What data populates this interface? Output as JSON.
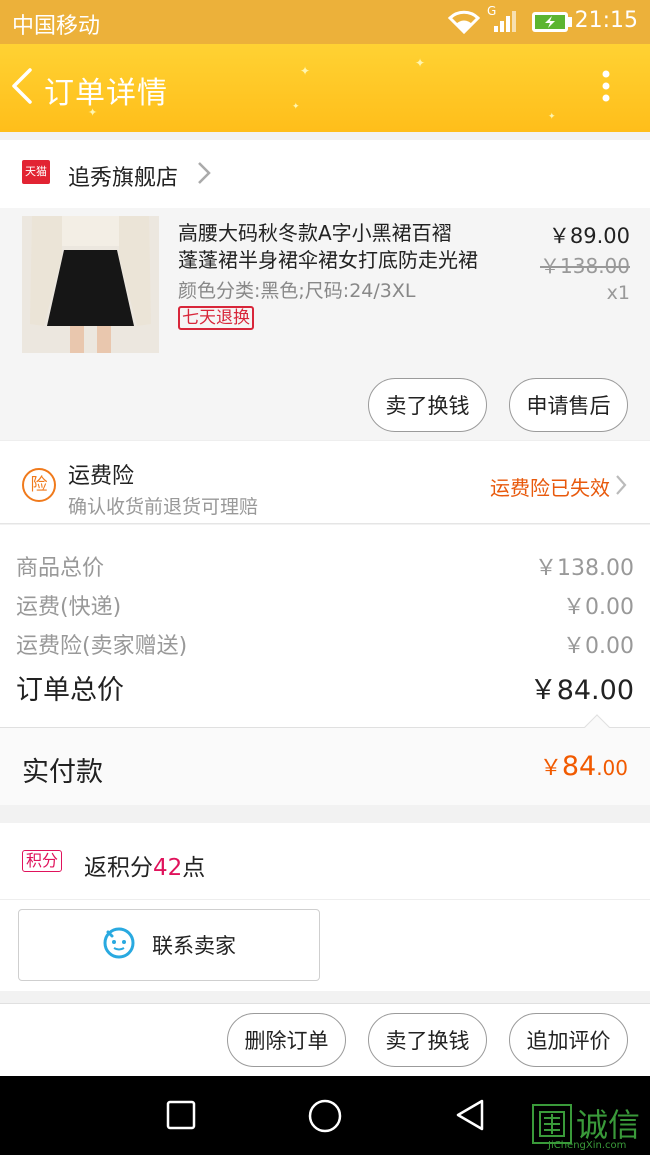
{
  "status_bar": {
    "carrier": "中国移动",
    "time": "21:15",
    "network": "G"
  },
  "nav": {
    "title": "订单详情"
  },
  "store": {
    "badge": "天猫",
    "name": "追秀旗舰店"
  },
  "product": {
    "name_line1": "高腰大码秋冬款A字小黑裙百褶",
    "name_line2": "蓬蓬裙半身裙伞裙女打底防走光裙",
    "spec": "颜色分类:黑色;尺码:24/3XL",
    "tag": "七天退换",
    "price": "￥89.00",
    "original_price": "￥138.00",
    "quantity": "x1"
  },
  "item_actions": {
    "sell_exchange": "卖了换钱",
    "after_sale": "申请售后"
  },
  "insurance": {
    "icon_char": "险",
    "title": "运费险",
    "subtitle": "确认收货前退货可理赔",
    "status": "运费险已失效"
  },
  "summary": {
    "rows": [
      {
        "label": "商品总价",
        "value": "￥138.00"
      },
      {
        "label": "运费(快递)",
        "value": "￥0.00"
      },
      {
        "label": "运费险(卖家赠送)",
        "value": "￥0.00"
      }
    ],
    "total_label": "订单总价",
    "total_value": "￥84.00"
  },
  "paid": {
    "label": "实付款",
    "currency": "￥",
    "integer": "84",
    "decimal": ".00"
  },
  "points": {
    "badge": "积分",
    "prefix": "返积分",
    "number": "42",
    "suffix": "点"
  },
  "contact": {
    "label": "联系卖家"
  },
  "bottom_actions": {
    "delete": "删除订单",
    "sell_exchange": "卖了换钱",
    "review": "追加评价"
  },
  "watermark": {
    "text": "诚信",
    "sub": "JiChengXin.com"
  },
  "colors": {
    "nav": "#ffc826",
    "status_bar": "#ecb13a",
    "accent_orange": "#f15a00",
    "tmall_red": "#d8263a",
    "points_pink": "#e0135c"
  }
}
